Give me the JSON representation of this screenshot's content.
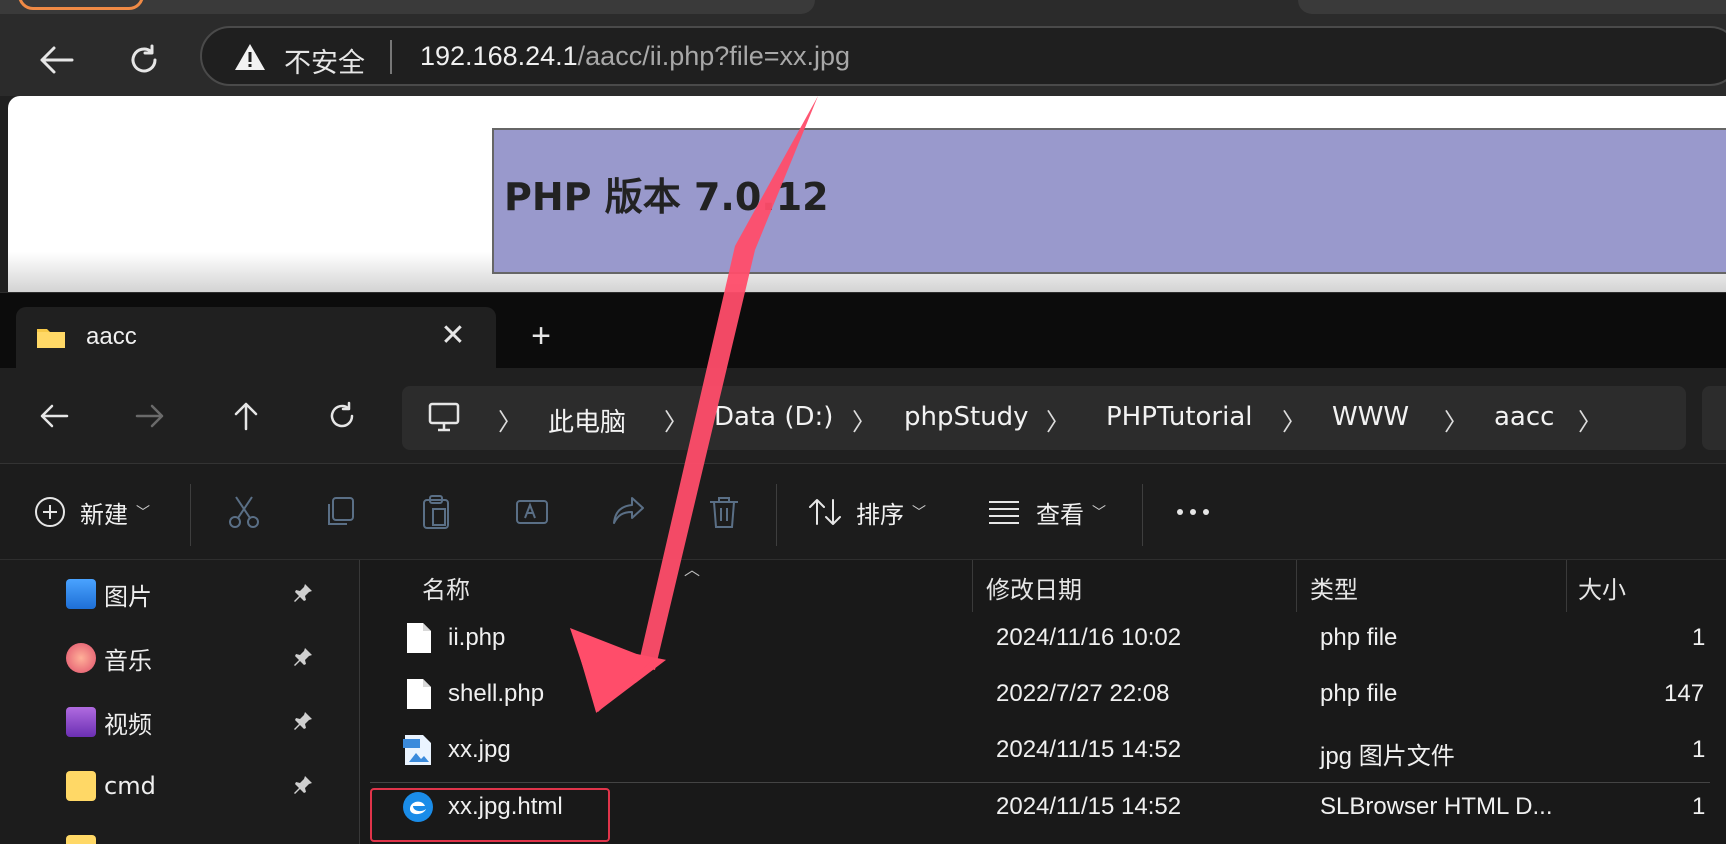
{
  "browser": {
    "security_label": "不安全",
    "url_host": "192.168.24.1",
    "url_path": "/aacc/ii.php?file=xx.jpg",
    "page_heading": "PHP 版本 7.0.12"
  },
  "explorer": {
    "tab_label": "aacc",
    "breadcrumb": [
      "此电脑",
      "Data (D:)",
      "phpStudy",
      "PHPTutorial",
      "WWW",
      "aacc"
    ],
    "commands": {
      "new_label": "新建",
      "sort_label": "排序",
      "view_label": "查看"
    },
    "sidebar": [
      {
        "label": "图片",
        "icon": "pictures-icon"
      },
      {
        "label": "音乐",
        "icon": "music-icon"
      },
      {
        "label": "视频",
        "icon": "videos-icon"
      },
      {
        "label": "cmd",
        "icon": "folder-icon"
      }
    ],
    "columns": {
      "name": "名称",
      "modified": "修改日期",
      "type": "类型",
      "size": "大小"
    },
    "files": [
      {
        "name": "ii.php",
        "modified": "2024/11/16 10:02",
        "type": "php file",
        "size": "1",
        "icon": "document-icon"
      },
      {
        "name": "shell.php",
        "modified": "2022/7/27 22:08",
        "type": "php file",
        "size": "147",
        "icon": "document-icon"
      },
      {
        "name": "xx.jpg",
        "modified": "2024/11/15 14:52",
        "type": "jpg 图片文件",
        "size": "1",
        "icon": "jpg-icon"
      },
      {
        "name": "xx.jpg.html",
        "modified": "2024/11/15 14:52",
        "type": "SLBrowser HTML D...",
        "size": "1",
        "icon": "browser-html-icon"
      }
    ]
  },
  "colors": {
    "annotation_red": "#ff4d6a",
    "php_banner": "#9999cc",
    "highlight_border": "#e0344a"
  }
}
